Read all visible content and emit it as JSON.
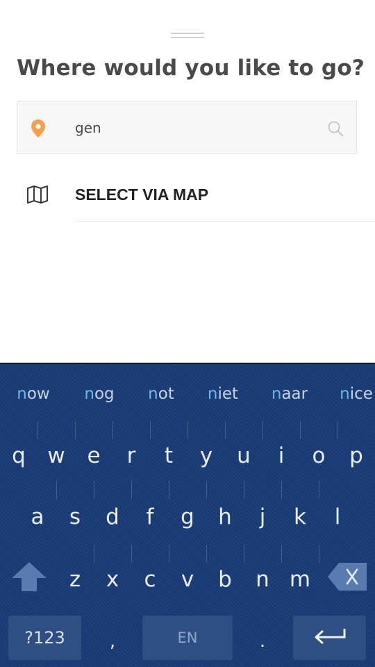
{
  "header": {
    "title": "Where would you like to go?"
  },
  "search": {
    "value": "gen"
  },
  "map_option": {
    "label": "SELECT VIA MAP"
  },
  "colors": {
    "pin": "#f7a04a",
    "accent": "#1a9ea8",
    "keyboard_bg": "#1a3c76"
  },
  "keyboard": {
    "suggestions": [
      {
        "typed": "n",
        "rest": "ow"
      },
      {
        "typed": "n",
        "rest": "og"
      },
      {
        "typed": "n",
        "rest": "ot"
      },
      {
        "typed": "n",
        "rest": "iet"
      },
      {
        "typed": "n",
        "rest": "aar"
      },
      {
        "typed": "n",
        "rest": "ice"
      }
    ],
    "row1": [
      "q",
      "w",
      "e",
      "r",
      "t",
      "y",
      "u",
      "i",
      "o",
      "p"
    ],
    "row2": [
      "a",
      "s",
      "d",
      "f",
      "g",
      "h",
      "j",
      "k",
      "l"
    ],
    "row3": [
      "z",
      "x",
      "c",
      "v",
      "b",
      "n",
      "m"
    ],
    "symbols_label": "?123",
    "comma": ",",
    "space_label": "EN",
    "period": "."
  }
}
